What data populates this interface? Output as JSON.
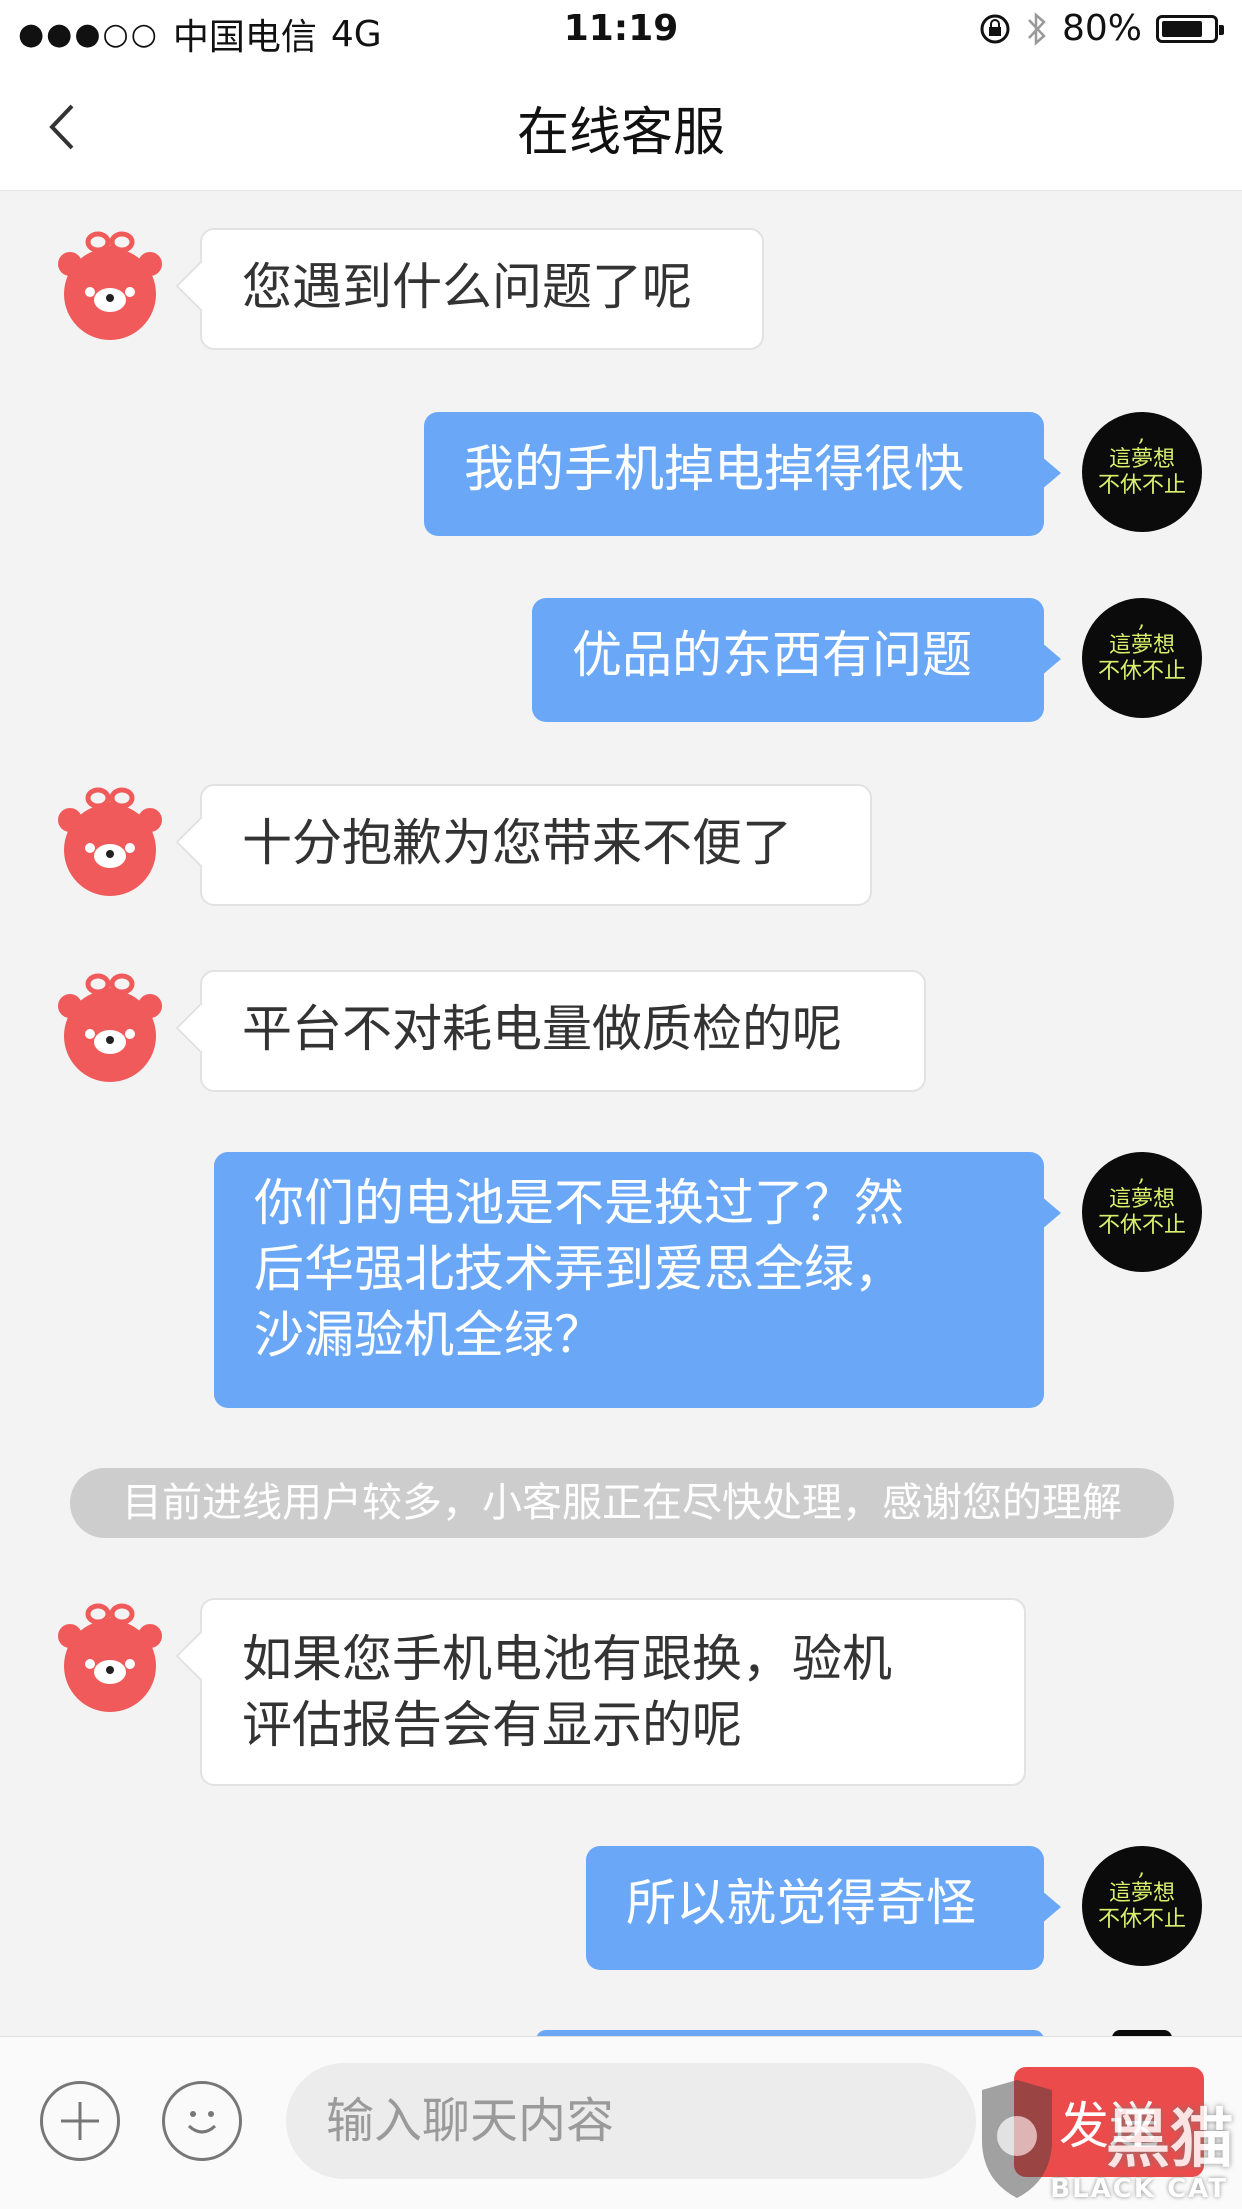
{
  "status_bar": {
    "signal_dots": "●●●○○",
    "carrier": "中国电信",
    "network": "4G",
    "time": "11:19",
    "battery_percent": "80%",
    "battery_level": 0.8
  },
  "nav": {
    "title": "在线客服"
  },
  "avatars": {
    "user_line1": "這夢想",
    "user_line2": "不休不止"
  },
  "messages": [
    {
      "sender": "agent",
      "text": "您遇到什么问题了呢"
    },
    {
      "sender": "user",
      "text": "我的手机掉电掉得很快"
    },
    {
      "sender": "user",
      "text": "优品的东西有问题"
    },
    {
      "sender": "agent",
      "text": "十分抱歉为您带来不便了"
    },
    {
      "sender": "agent",
      "text": "平台不对耗电量做质检的呢"
    },
    {
      "sender": "user",
      "lines": [
        "你们的电池是不是换过了？然",
        "后华强北技术弄到爱思全绿，",
        "沙漏验机全绿？"
      ]
    },
    {
      "sender": "system",
      "text": "目前进线用户较多，小客服正在尽快处理，感谢您的理解"
    },
    {
      "sender": "agent",
      "lines": [
        "如果您手机电池有跟换，验机",
        "评估报告会有显示的呢"
      ]
    },
    {
      "sender": "user",
      "text": "所以就觉得奇怪"
    }
  ],
  "input_bar": {
    "placeholder": "输入聊天内容",
    "send_label": "发送"
  },
  "watermark": {
    "text": "黑猫",
    "subtext": "BLACK CAT"
  },
  "colors": {
    "user_bubble": "#6aa8f7",
    "agent_bubble": "#ffffff",
    "send_button": "#ec4b4b",
    "bear_avatar": "#f05a5a"
  }
}
